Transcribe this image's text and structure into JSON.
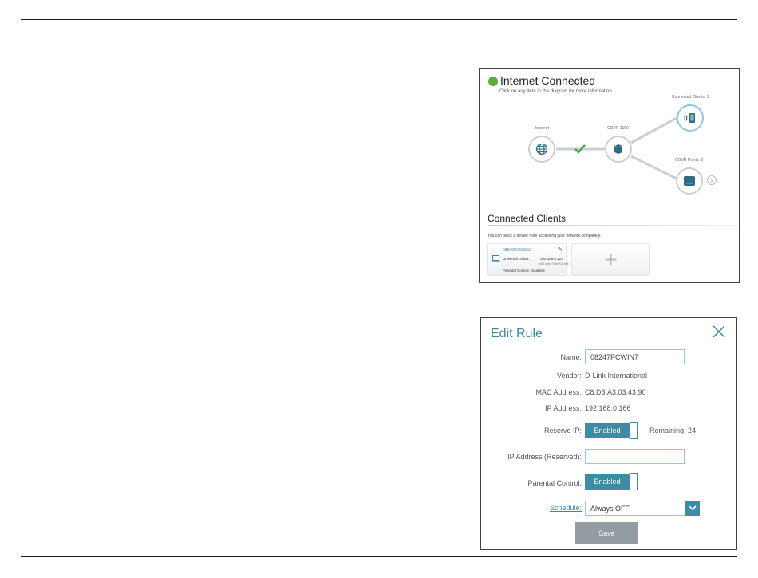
{
  "status": {
    "title": "Internet Connected",
    "hint": "Click on any item in the diagram for more information.",
    "color": "#5aae36"
  },
  "diagram": {
    "internet_label": "Internet",
    "router_label": "COVR-1100",
    "clients_label": "Connected Clients: 1",
    "points_label": "COVR Points: 0"
  },
  "connected_clients": {
    "title": "Connected Clients",
    "hint": "You can block a device from accessing your network completely.",
    "client": {
      "name": "08826PCWIN10",
      "vendor": "Universal Globa...",
      "ip": "192.168.0.124",
      "mac": "fe80::c5e4:f7a6:ff1a:e8b",
      "parental": "Parental Control: Disabled"
    },
    "add_symbol": "+"
  },
  "edit_rule": {
    "title": "Edit Rule",
    "name_label": "Name:",
    "name_value": "08247PCWIN7",
    "vendor_label": "Vendor:",
    "vendor_value": "D-Link International",
    "mac_label": "MAC Address:",
    "mac_value": "C8:D3:A3:03:43:90",
    "ip_label": "IP Address:",
    "ip_value": "192.168.0.166",
    "reserve_label": "Reserve IP:",
    "reserve_state": "Enabled",
    "remaining": "Remaining: 24",
    "reserved_ip_label": "IP Address (Reserved):",
    "reserved_ip_value": "",
    "parental_label": "Parental Control:",
    "parental_state": "Enabled",
    "schedule_label": "Schedule:",
    "schedule_value": "Always OFF",
    "save_label": "Save",
    "accent_color": "#3d8ca4"
  }
}
